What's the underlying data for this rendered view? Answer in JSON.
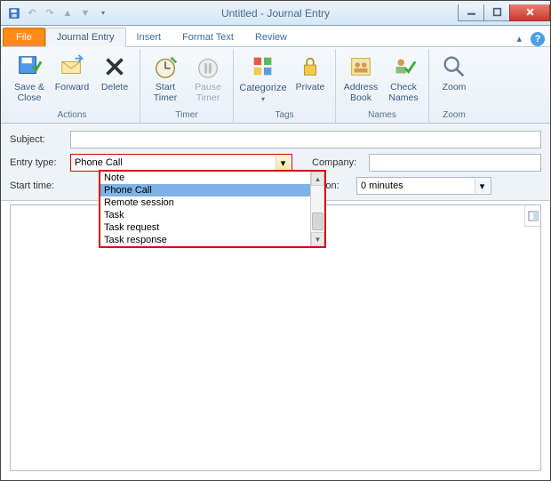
{
  "title": "Untitled - Journal Entry",
  "tabs": {
    "file": "File",
    "journal": "Journal Entry",
    "insert": "Insert",
    "format": "Format Text",
    "review": "Review"
  },
  "ribbon": {
    "actions": {
      "label": "Actions",
      "save": "Save & Close",
      "forward": "Forward",
      "delete": "Delete"
    },
    "timer": {
      "label": "Timer",
      "start": "Start Timer",
      "pause": "Pause Timer"
    },
    "tags": {
      "label": "Tags",
      "categorize": "Categorize",
      "private": "Private"
    },
    "names": {
      "label": "Names",
      "address": "Address Book",
      "check": "Check Names"
    },
    "zoom": {
      "label": "Zoom",
      "zoom": "Zoom"
    }
  },
  "form": {
    "subject_label": "Subject:",
    "entrytype_label": "Entry type:",
    "entrytype_value": "Phone Call",
    "company_label": "Company:",
    "start_label": "Start time:",
    "duration_label": "Duration:",
    "duration_value": "0 minutes"
  },
  "dropdown": {
    "items": [
      "Note",
      "Phone Call",
      "Remote session",
      "Task",
      "Task request",
      "Task response"
    ],
    "selected_index": 1
  }
}
